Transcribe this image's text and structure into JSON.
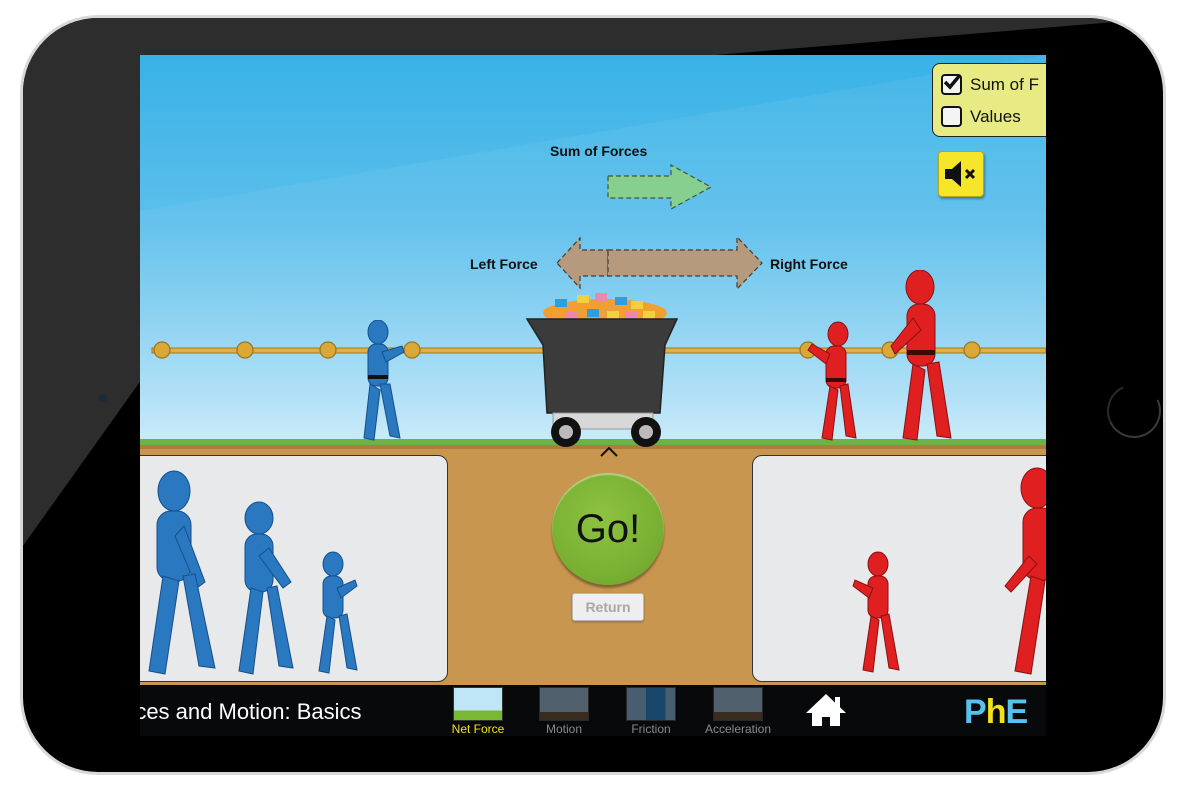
{
  "app": {
    "title": "Forces and Motion: Basics",
    "title_visible": "rces and Motion: Basics"
  },
  "controls_panel": {
    "items": [
      {
        "label": "Sum of Forces",
        "label_visible": "Sum of F",
        "checked": true
      },
      {
        "label": "Values",
        "label_visible": "Values",
        "checked": false
      }
    ]
  },
  "sound": {
    "state": "muted",
    "icon": "speaker-muted-icon"
  },
  "forces": {
    "sum_label": "Sum of Forces",
    "left_label": "Left Force",
    "right_label": "Right Force",
    "sum_direction": "right"
  },
  "scene": {
    "left_team_on_rope": 1,
    "right_team_on_rope": 2,
    "left_toolbox_pullers": 3,
    "right_toolbox_pullers_visible": 2
  },
  "buttons": {
    "go_label": "Go!",
    "return_label": "Return"
  },
  "navbar": {
    "tabs": [
      {
        "label": "Net Force",
        "active": true
      },
      {
        "label": "Motion",
        "active": false
      },
      {
        "label": "Friction",
        "active": false
      },
      {
        "label": "Acceleration",
        "active": false
      }
    ],
    "home_icon": "home-icon",
    "logo": {
      "p": "P",
      "h": "h",
      "e": "E"
    }
  },
  "colors": {
    "sky": "#38b2e6",
    "ground": "#c8964f",
    "panel": "#e8e9eb",
    "control_panel": "#e8ea84",
    "go_button": "#7ab833",
    "sum_arrow": "#86cf8e",
    "force_arrow": "#b59a7e",
    "active_tab": "#f1e21a",
    "phet_blue": "#56c3ef",
    "phet_yellow": "#f1e21a",
    "left_team": "#2a78c0",
    "right_team": "#e02020"
  }
}
